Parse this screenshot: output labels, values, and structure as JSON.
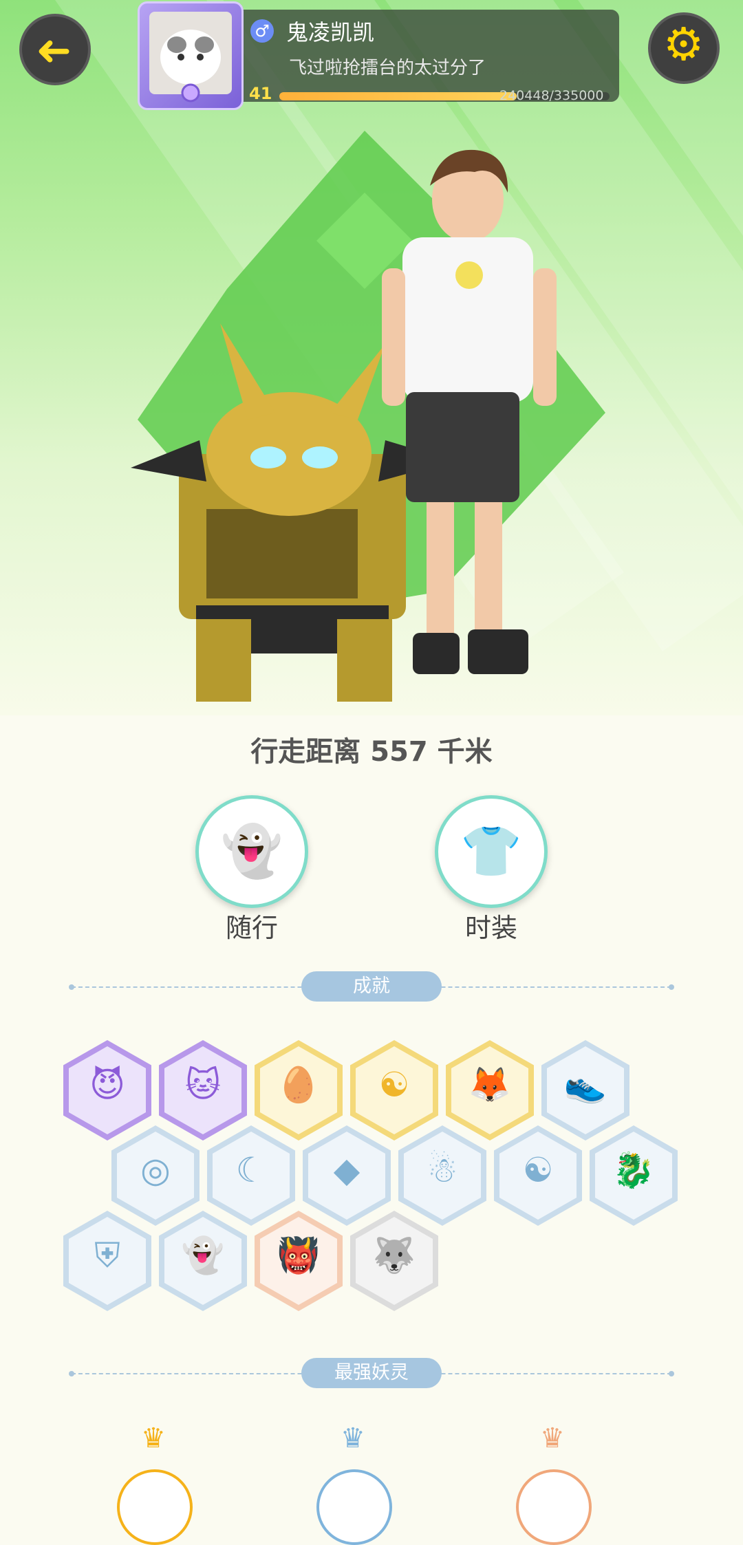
{
  "player": {
    "name": "鬼凌凯凯",
    "signature": "飞过啦抢擂台的太过分了",
    "level": "41",
    "exp_text": "240448/335000",
    "exp_progress": 0.718
  },
  "icons": {
    "back": "arrow-left-icon",
    "settings": "gear-icon",
    "gender": "male-icon"
  },
  "glyphs": {
    "back": "➜",
    "settings": "⚙",
    "gender": "♂"
  },
  "stats": {
    "distance": "行走距离 557 千米"
  },
  "categories": {
    "companion": {
      "label": "随行",
      "glyph": "👻"
    },
    "fashion": {
      "label": "时装",
      "glyph": "👕"
    }
  },
  "achievements": {
    "title": "成就",
    "badges": [
      {
        "icon": "devil-face-icon",
        "variant": "purple",
        "glyph": "😈"
      },
      {
        "icon": "cart-cat-icon",
        "variant": "purple",
        "glyph": "🐱"
      },
      {
        "icon": "egg-icon",
        "variant": "gold",
        "glyph": "🥚"
      },
      {
        "icon": "yinyang-swirl-icon",
        "variant": "gold",
        "glyph": "☯"
      },
      {
        "icon": "fox-spirit-icon",
        "variant": "gold",
        "glyph": "🦊"
      },
      {
        "icon": "sneaker-icon",
        "variant": "blue",
        "glyph": "👟"
      },
      {
        "icon": "compass-icon",
        "variant": "blue",
        "glyph": "◎"
      },
      {
        "icon": "moon-icon",
        "variant": "blue",
        "glyph": "☾"
      },
      {
        "icon": "crystal-icon",
        "variant": "blue",
        "glyph": "◆"
      },
      {
        "icon": "climber-icon",
        "variant": "blue",
        "glyph": "☃"
      },
      {
        "icon": "yinyang-book-icon",
        "variant": "blue",
        "glyph": "☯"
      },
      {
        "icon": "dragon-fish-icon",
        "variant": "blue",
        "glyph": "🐉"
      },
      {
        "icon": "shield-icon",
        "variant": "blue",
        "glyph": "⛨"
      },
      {
        "icon": "ghost-icon",
        "variant": "blue",
        "glyph": "👻"
      },
      {
        "icon": "demon-icon",
        "variant": "orange",
        "glyph": "👹"
      },
      {
        "icon": "wolf-icon",
        "variant": "gray",
        "glyph": "🐺"
      }
    ]
  },
  "strongest": {
    "title": "最强妖灵"
  },
  "ranks": [
    {
      "icon": "gold-crown-icon",
      "color": "#f5b21a"
    },
    {
      "icon": "silver-crown-icon",
      "color": "#7fb4dc"
    },
    {
      "icon": "bronze-crown-icon",
      "color": "#f0a77a"
    }
  ]
}
